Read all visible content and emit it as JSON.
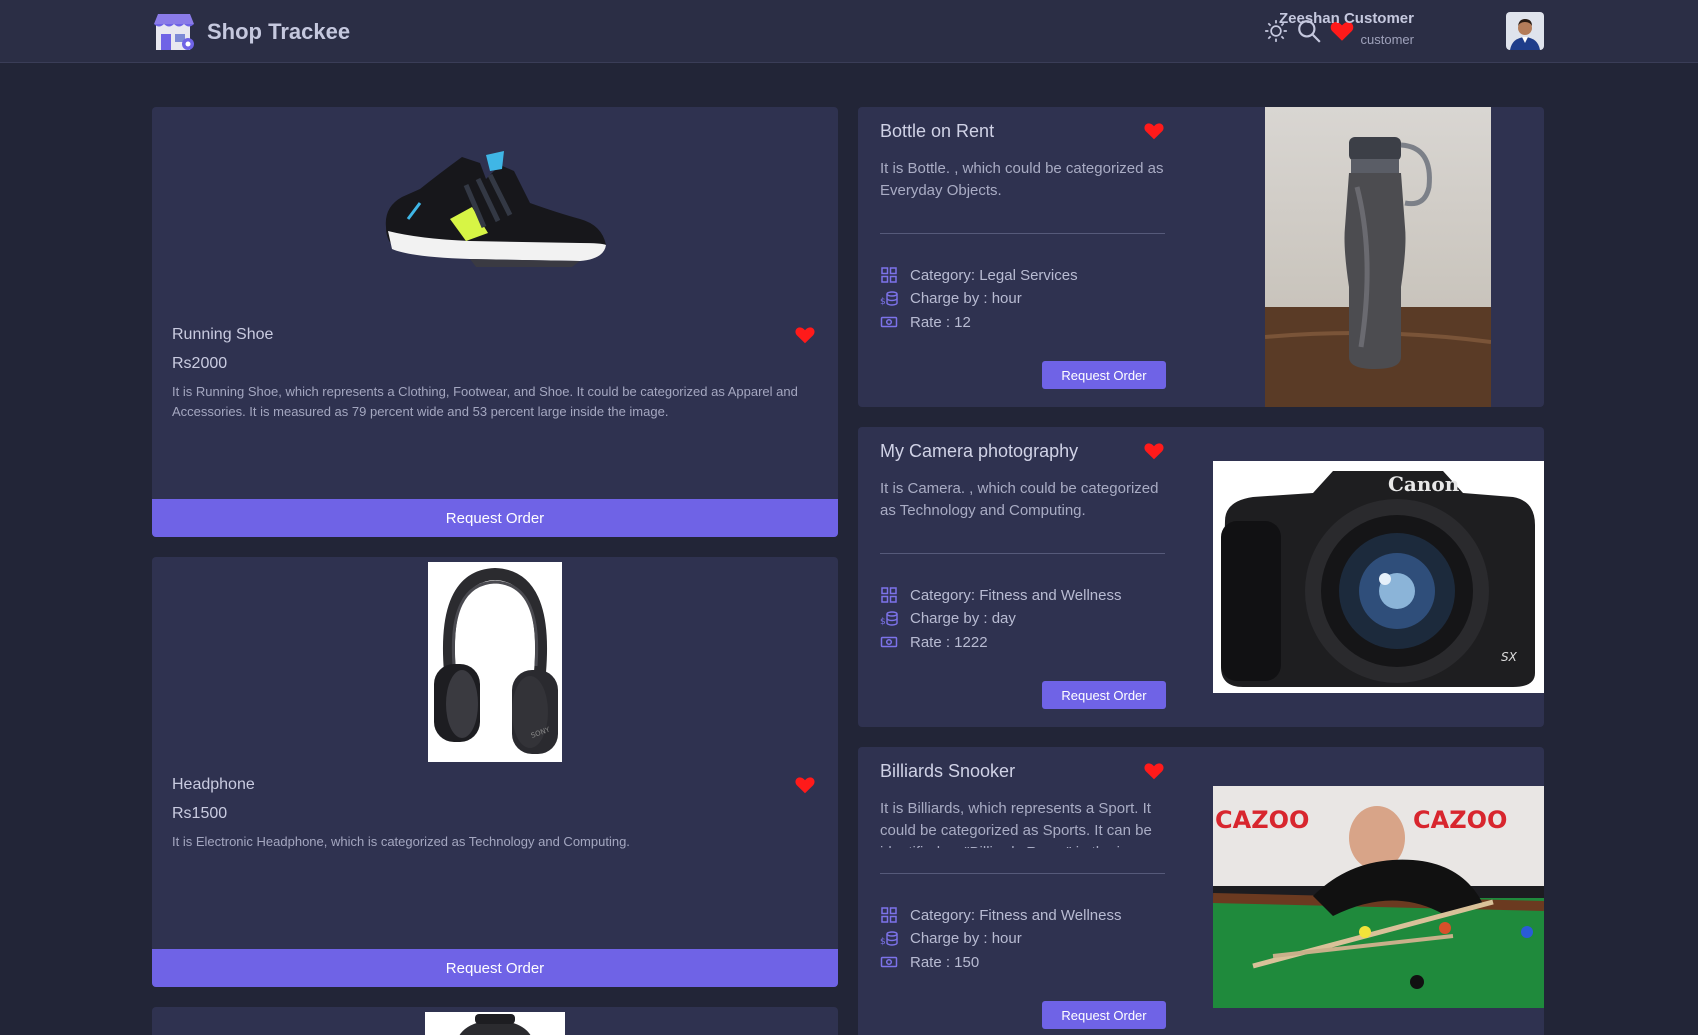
{
  "header": {
    "app_name": "Shop Trackee",
    "user_name": "Zeeshan Customer",
    "user_role": "customer",
    "icons": [
      "sun-icon",
      "search-icon",
      "heart-icon"
    ]
  },
  "products": [
    {
      "name": "Running Shoe",
      "price": "Rs2000",
      "description": "It is Running Shoe, which represents a Clothing, Footwear, and Shoe. It could be categorized as Apparel and Accessories. It is measured as 79 percent wide and 53 percent large inside the image.",
      "button": "Request Order"
    },
    {
      "name": "Headphone",
      "price": "Rs1500",
      "description": "It is Electronic Headphone, which is categorized as Technology and Computing.",
      "button": "Request Order"
    }
  ],
  "services": [
    {
      "title": "Bottle on Rent",
      "description": "It is Bottle. , which could be categorized as Everyday Objects.",
      "category": "Category: Legal Services",
      "charge_by": "Charge by : hour",
      "rate": "Rate : 12",
      "button": "Request Order"
    },
    {
      "title": "My Camera photography",
      "description": "It is Camera. , which could be categorized as Technology and Computing.",
      "category": "Category: Fitness and Wellness",
      "charge_by": "Charge by : day",
      "rate": "Rate : 1222",
      "button": "Request Order"
    },
    {
      "title": "Billiards Snooker",
      "description": "It is Billiards, which represents a Sport. It could be categorized as Sports. It can be identified as \"Billiards Room\" in the image.",
      "category": "Category: Fitness and Wellness",
      "charge_by": "Charge by : hour",
      "rate": "Rate : 150",
      "button": "Request Order"
    }
  ],
  "colors": {
    "background": "#222537",
    "card": "#2f3250",
    "accent": "#6f63e6",
    "heart": "#ff1a1a"
  }
}
